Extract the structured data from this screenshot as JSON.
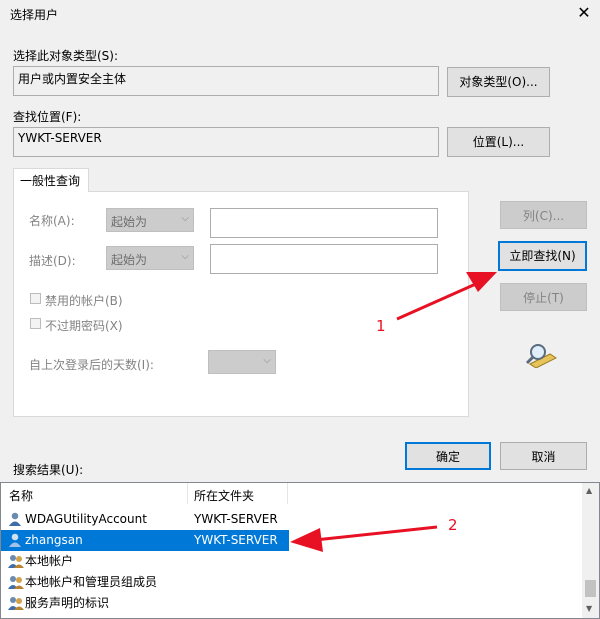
{
  "window": {
    "title": "选择用户"
  },
  "object_type": {
    "label": "选择此对象类型(S):",
    "value": "用户或内置安全主体",
    "button": "对象类型(O)..."
  },
  "location": {
    "label": "查找位置(F):",
    "value": "YWKT-SERVER",
    "button": "位置(L)..."
  },
  "tab": {
    "label": "一般性查询"
  },
  "query": {
    "name_label": "名称(A):",
    "name_op": "起始为",
    "desc_label": "描述(D):",
    "desc_op": "起始为",
    "disabled_accounts": "禁用的帐户(B)",
    "no_expire_pwd": "不过期密码(X)",
    "days_label": "自上次登录后的天数(I):"
  },
  "side_buttons": {
    "columns": "列(C)...",
    "find_now": "立即查找(N)",
    "stop": "停止(T)"
  },
  "actions": {
    "ok": "确定",
    "cancel": "取消"
  },
  "results": {
    "label": "搜索结果(U):",
    "columns": [
      "名称",
      "所在文件夹"
    ],
    "rows": [
      {
        "name": "WDAGUtilityAccount",
        "folder": "YWKT-SERVER",
        "selected": false,
        "icon": "user-icon"
      },
      {
        "name": "zhangsan",
        "folder": "YWKT-SERVER",
        "selected": true,
        "icon": "user-icon"
      },
      {
        "name": "本地帐户",
        "folder": "",
        "selected": false,
        "icon": "group-icon"
      },
      {
        "name": "本地帐户和管理员组成员",
        "folder": "",
        "selected": false,
        "icon": "group-icon"
      },
      {
        "name": "服务声明的标识",
        "folder": "",
        "selected": false,
        "icon": "group-icon"
      }
    ]
  },
  "annotations": {
    "a1": "1",
    "a2": "2",
    "color": "#e81123"
  },
  "colors": {
    "accent": "#0078d7"
  }
}
